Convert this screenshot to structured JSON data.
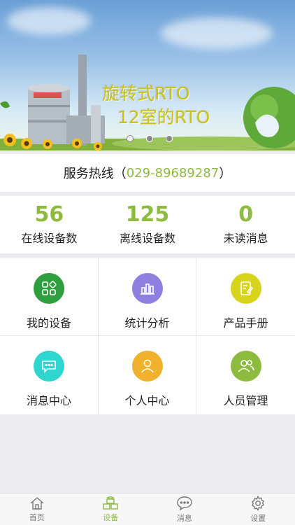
{
  "banner": {
    "line1": "旋转式RTO",
    "line2": "12室的RTO",
    "pager_dots": 3,
    "active_dot": 0
  },
  "hotline": {
    "label": "服务热线（",
    "number": "029-89689287",
    "suffix": "）"
  },
  "stats": [
    {
      "value": "56",
      "label": "在线设备数"
    },
    {
      "value": "125",
      "label": "离线设备数"
    },
    {
      "value": "0",
      "label": "未读消息"
    }
  ],
  "grid": [
    {
      "label": "我的设备",
      "icon": "grid-icon",
      "color": "#2e9e3e"
    },
    {
      "label": "统计分析",
      "icon": "bar-chart-icon",
      "color": "#8f7fe0"
    },
    {
      "label": "产品手册",
      "icon": "manual-icon",
      "color": "#d8d41e"
    },
    {
      "label": "消息中心",
      "icon": "chat-icon",
      "color": "#2fd6d0"
    },
    {
      "label": "个人中心",
      "icon": "person-icon",
      "color": "#f0b22c"
    },
    {
      "label": "人员管理",
      "icon": "people-icon",
      "color": "#8dbb3f"
    }
  ],
  "tabbar": [
    {
      "label": "首页",
      "icon": "home-icon",
      "active": false
    },
    {
      "label": "设备",
      "icon": "boxes-icon",
      "active": true
    },
    {
      "label": "消息",
      "icon": "message-icon",
      "active": false
    },
    {
      "label": "设置",
      "icon": "gear-icon",
      "active": false
    }
  ],
  "colors": {
    "accent": "#8dbb3f",
    "background": "#ececf0"
  }
}
